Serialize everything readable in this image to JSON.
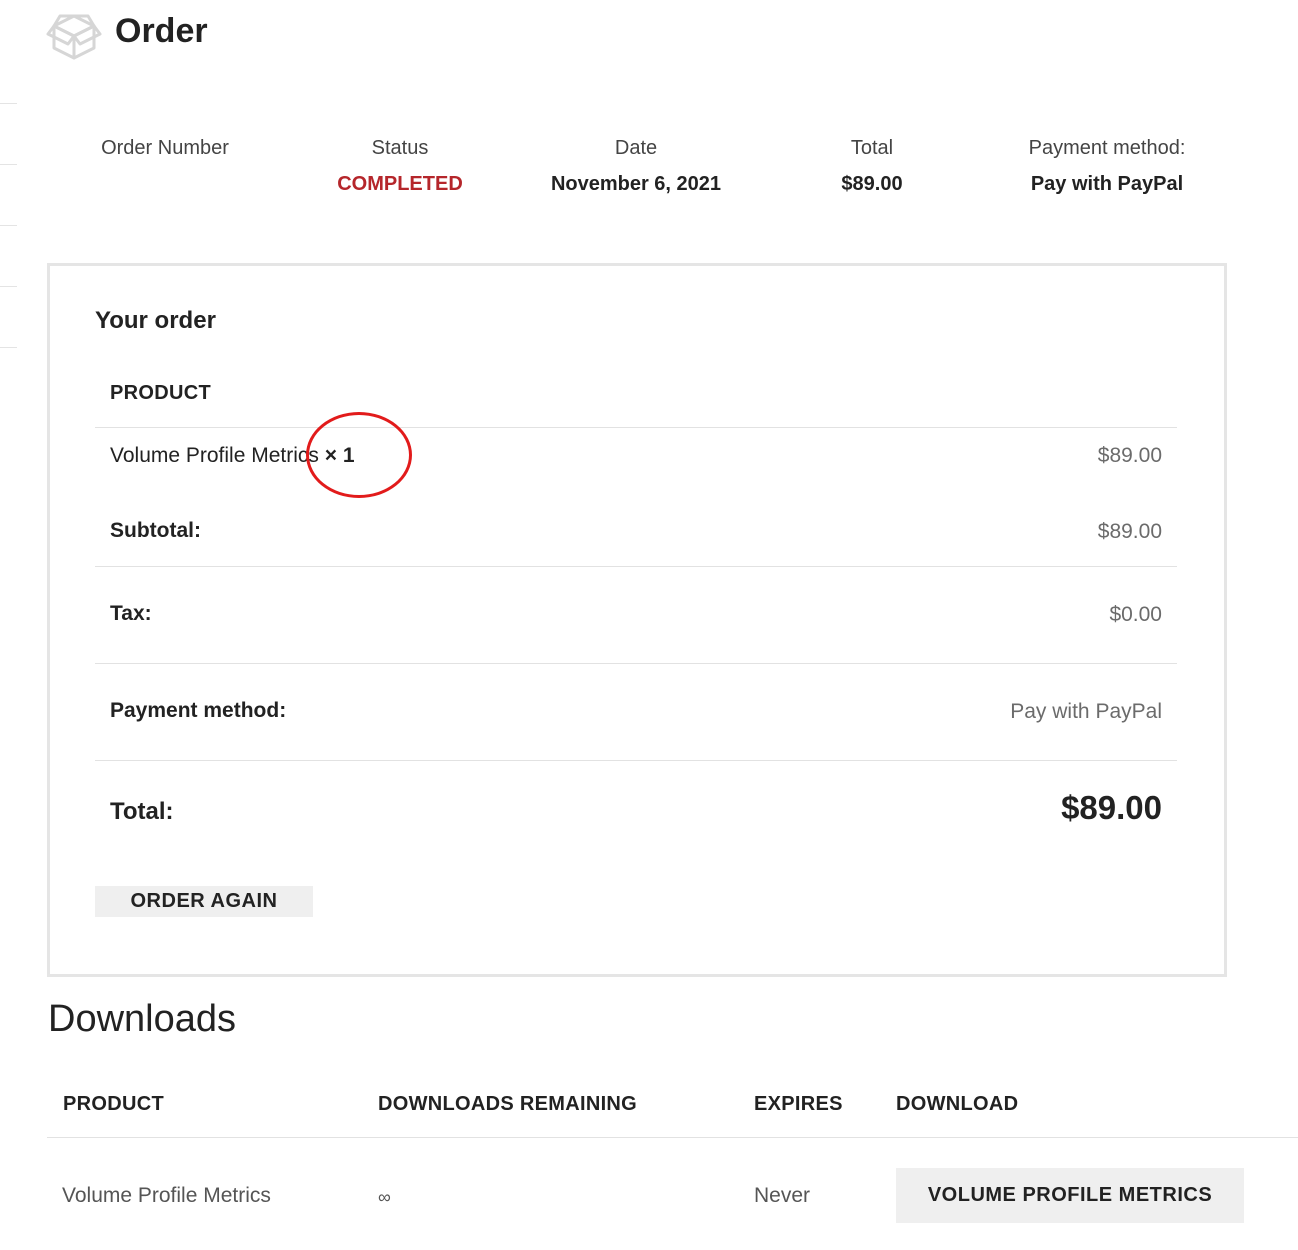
{
  "header": {
    "title": "Order",
    "icon": "box-icon"
  },
  "summary": {
    "order_number_label": "Order Number",
    "status_label": "Status",
    "status_value": "COMPLETED",
    "date_label": "Date",
    "date_value": "November 6, 2021",
    "total_label": "Total",
    "total_value": "$89.00",
    "payment_label": "Payment method:",
    "payment_value": "Pay with PayPal"
  },
  "order": {
    "title": "Your order",
    "product_header": "PRODUCT",
    "item": {
      "name": "Volume Profile Metrics",
      "quantity": "× 1",
      "price": "$89.00"
    },
    "subtotal_label": "Subtotal:",
    "subtotal_value": "$89.00",
    "tax_label": "Tax:",
    "tax_value": "$0.00",
    "payment_label": "Payment method:",
    "payment_value": "Pay with PayPal",
    "total_label": "Total:",
    "total_value": "$89.00",
    "order_again_label": "ORDER AGAIN"
  },
  "downloads": {
    "title": "Downloads",
    "headers": [
      "PRODUCT",
      "DOWNLOADS REMAINING",
      "EXPIRES",
      "DOWNLOAD"
    ],
    "rows": [
      {
        "product": "Volume Profile Metrics",
        "remaining": "∞",
        "expires": "Never",
        "download_label": "VOLUME PROFILE METRICS"
      }
    ]
  },
  "colors": {
    "status": "#b5262b",
    "annotation": "#e21b1b",
    "button_bg": "#efefef",
    "border": "#e5e5e5"
  }
}
